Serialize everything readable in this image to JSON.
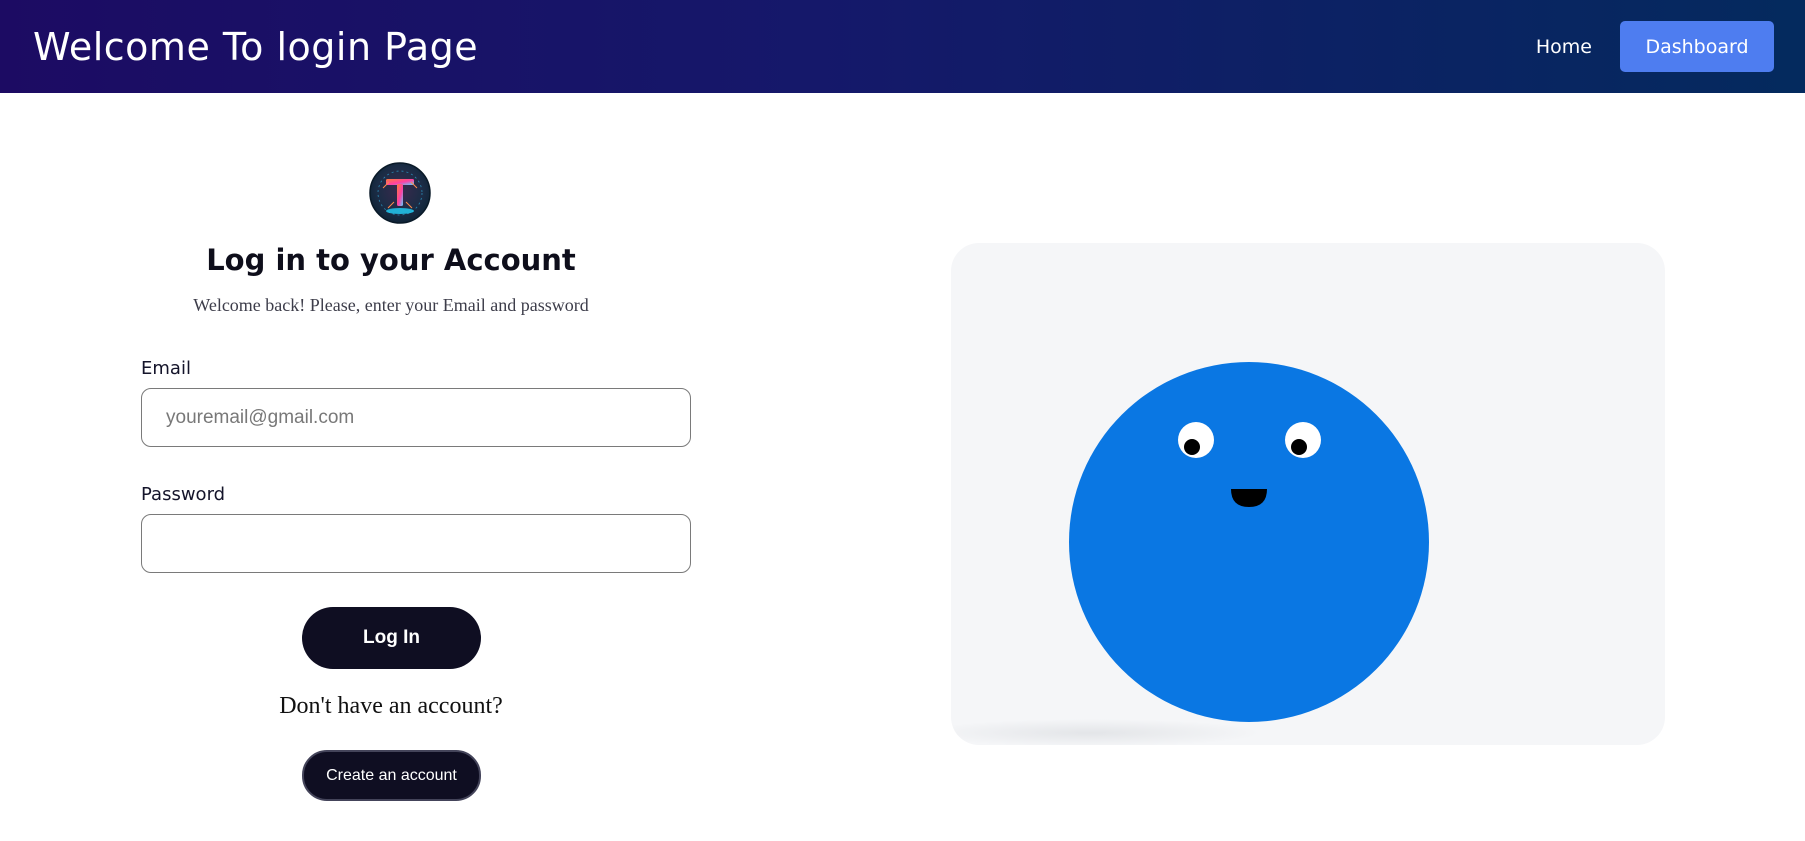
{
  "header": {
    "title": "Welcome To login Page",
    "nav": {
      "home": "Home",
      "dashboard": "Dashboard"
    }
  },
  "login": {
    "logo_icon": "T-circuit-logo-icon",
    "heading": "Log in to your Account",
    "subtext": "Welcome back! Please, enter your Email and password",
    "email": {
      "label": "Email",
      "placeholder": "youremail@gmail.com",
      "value": ""
    },
    "password": {
      "label": "Password",
      "placeholder": "",
      "value": ""
    },
    "login_button": "Log In",
    "no_account": "Don't have an account?",
    "create_button": "Create an account"
  },
  "mascot": {
    "face_icon": "smiling-ball-mascot-icon",
    "color": "#0a77e3",
    "panel_color": "#f5f6f8"
  },
  "colors": {
    "header_start": "#1c0b63",
    "header_end": "#042a5e",
    "dashboard_button": "#4e7df0",
    "primary_button": "#0f0e22"
  }
}
